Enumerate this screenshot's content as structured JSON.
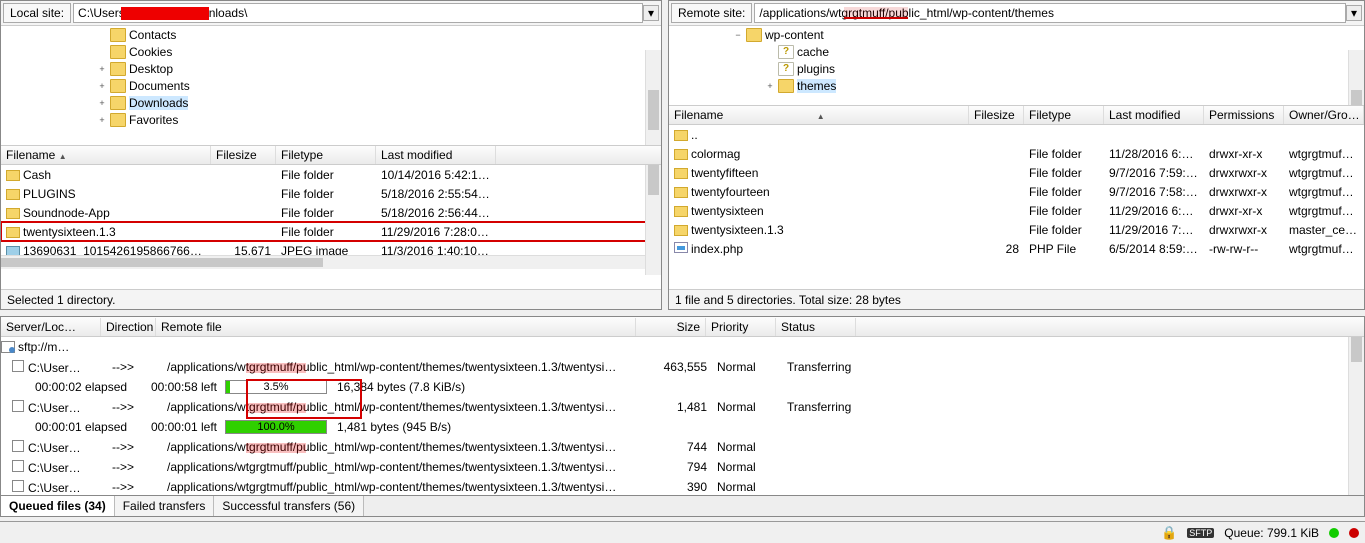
{
  "local": {
    "label": "Local site:",
    "path": "C:\\Users\\████████\\Downloads\\",
    "tree": [
      {
        "indent": 6,
        "name": "Contacts",
        "expander": ""
      },
      {
        "indent": 6,
        "name": "Cookies",
        "expander": ""
      },
      {
        "indent": 6,
        "name": "Desktop",
        "expander": "+"
      },
      {
        "indent": 6,
        "name": "Documents",
        "expander": "+"
      },
      {
        "indent": 6,
        "name": "Downloads",
        "expander": "+",
        "selected": true
      },
      {
        "indent": 6,
        "name": "Favorites",
        "expander": "+"
      }
    ],
    "columns": [
      "Filename",
      "Filesize",
      "Filetype",
      "Last modified"
    ],
    "files": [
      {
        "name": "Cash",
        "size": "",
        "type": "File folder",
        "mod": "10/14/2016 5:42:15…",
        "icon": "folder"
      },
      {
        "name": "PLUGINS",
        "size": "",
        "type": "File folder",
        "mod": "5/18/2016 2:55:54 …",
        "icon": "folder"
      },
      {
        "name": "Soundnode-App",
        "size": "",
        "type": "File folder",
        "mod": "5/18/2016 2:56:44 …",
        "icon": "folder"
      },
      {
        "name": "twentysixteen.1.3",
        "size": "",
        "type": "File folder",
        "mod": "11/29/2016 7:28:00…",
        "icon": "folder",
        "highlight": true
      },
      {
        "name": "13690631_10154261958667667_…",
        "size": "15,671",
        "type": "JPEG image",
        "mod": "11/3/2016 1:40:10 …",
        "icon": "image"
      }
    ],
    "status": "Selected 1 directory."
  },
  "remote": {
    "label": "Remote site:",
    "path": "/applications/████████/public_html/wp-content/themes",
    "tree": [
      {
        "indent": 4,
        "name": "wp-content",
        "expander": "−"
      },
      {
        "indent": 6,
        "name": "cache",
        "expander": "",
        "q": true
      },
      {
        "indent": 6,
        "name": "plugins",
        "expander": "",
        "q": true
      },
      {
        "indent": 6,
        "name": "themes",
        "expander": "+",
        "selected": true
      }
    ],
    "columns": [
      "Filename",
      "Filesize",
      "Filetype",
      "Last modified",
      "Permissions",
      "Owner/Gro…"
    ],
    "files": [
      {
        "name": "..",
        "icon": "folder"
      },
      {
        "name": "colormag",
        "size": "",
        "type": "File folder",
        "mod": "11/28/2016 6:0…",
        "perm": "drwxr-xr-x",
        "own": "wtgrgtmuf…",
        "icon": "folder"
      },
      {
        "name": "twentyfifteen",
        "size": "",
        "type": "File folder",
        "mod": "9/7/2016 7:59:0…",
        "perm": "drwxrwxr-x",
        "own": "wtgrgtmuf…",
        "icon": "folder"
      },
      {
        "name": "twentyfourteen",
        "size": "",
        "type": "File folder",
        "mod": "9/7/2016 7:58:5…",
        "perm": "drwxrwxr-x",
        "own": "wtgrgtmuf…",
        "icon": "folder"
      },
      {
        "name": "twentysixteen",
        "size": "",
        "type": "File folder",
        "mod": "11/29/2016 6:3…",
        "perm": "drwxr-xr-x",
        "own": "wtgrgtmuf…",
        "icon": "folder"
      },
      {
        "name": "twentysixteen.1.3",
        "size": "",
        "type": "File folder",
        "mod": "11/29/2016 7:2…",
        "perm": "drwxrwxr-x",
        "own": "master_cer…",
        "icon": "folder"
      },
      {
        "name": "index.php",
        "size": "28",
        "type": "PHP File",
        "mod": "6/5/2014 8:59:1…",
        "perm": "-rw-rw-r--",
        "own": "wtgrgtmuf…",
        "icon": "php"
      }
    ],
    "status": "1 file and 5 directories. Total size: 28 bytes"
  },
  "queue": {
    "columns": [
      "Server/Loc…",
      "Direction",
      "Remote file",
      "Size",
      "Priority",
      "Status"
    ],
    "server_row": "sftp://m…",
    "items": [
      {
        "loc": "C:\\User…",
        "dir": "-->>",
        "remote": "/applications/wtgrgtmuff/public_html/wp-content/themes/twentysixteen.1.3/twentysi…",
        "size": "463,555",
        "pri": "Normal",
        "status": "Transferring",
        "elapsed": "00:00:02 elapsed",
        "left": "00:00:58 left",
        "pct": "3.5%",
        "barw": 3.5,
        "rate": "16,384 bytes (7.8 KiB/s)"
      },
      {
        "loc": "C:\\User…",
        "dir": "-->>",
        "remote": "/applications/wtgrgtmuff/public_html/wp-content/themes/twentysixteen.1.3/twentysi…",
        "size": "1,481",
        "pri": "Normal",
        "status": "Transferring",
        "elapsed": "00:00:01 elapsed",
        "left": "00:00:01 left",
        "pct": "100.0%",
        "barw": 100,
        "rate": "1,481 bytes (945 B/s)"
      },
      {
        "loc": "C:\\User…",
        "dir": "-->>",
        "remote": "/applications/wtgrgtmuff/public_html/wp-content/themes/twentysixteen.1.3/twentysi…",
        "size": "744",
        "pri": "Normal",
        "status": ""
      },
      {
        "loc": "C:\\User…",
        "dir": "-->>",
        "remote": "/applications/wtgrgtmuff/public_html/wp-content/themes/twentysixteen.1.3/twentysi…",
        "size": "794",
        "pri": "Normal",
        "status": ""
      },
      {
        "loc": "C:\\User…",
        "dir": "-->>",
        "remote": "/applications/wtgrgtmuff/public_html/wp-content/themes/twentysixteen.1.3/twentysi…",
        "size": "390",
        "pri": "Normal",
        "status": ""
      }
    ]
  },
  "tabs": [
    {
      "label": "Queued files (34)",
      "active": true
    },
    {
      "label": "Failed transfers",
      "active": false
    },
    {
      "label": "Successful transfers (56)",
      "active": false
    }
  ],
  "statusbar": {
    "queue": "Queue: 799.1 KiB"
  }
}
